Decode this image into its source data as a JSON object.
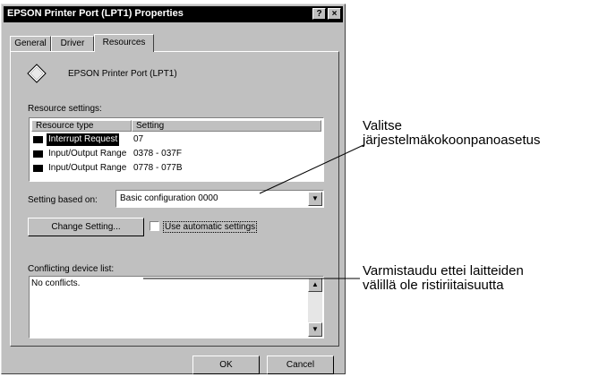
{
  "dialog": {
    "title": "EPSON Printer Port (LPT1) Properties",
    "help_label": "?",
    "close_label": "×",
    "tabs": [
      {
        "label": "General",
        "active": false
      },
      {
        "label": "Driver",
        "active": false
      },
      {
        "label": "Resources",
        "active": true
      }
    ],
    "device_name": "EPSON Printer Port (LPT1)",
    "resource_settings_label": "Resource settings:",
    "table": {
      "headers": [
        "Resource type",
        "Setting"
      ],
      "rows": [
        {
          "type": "Interrupt Request",
          "setting": "07"
        },
        {
          "type": "Input/Output Range",
          "setting": "0378 - 037F"
        },
        {
          "type": "Input/Output Range",
          "setting": "0778 - 077B"
        }
      ]
    },
    "setting_based_on_label": "Setting based on:",
    "setting_based_on_value": "Basic configuration 0000",
    "change_setting_label": "Change Setting...",
    "use_automatic_label": "Use automatic settings",
    "use_automatic_checked": false,
    "conflicting_label": "Conflicting device list:",
    "conflicting_text": "No conflicts.",
    "ok_label": "OK",
    "cancel_label": "Cancel"
  },
  "annotations": {
    "first_line1": "Valitse",
    "first_line2": "järjestelmäkokoonpanoasetus",
    "second_line1": "Varmistaudu ettei laitteiden",
    "second_line2": "välillä ole ristiriitaisuutta"
  }
}
